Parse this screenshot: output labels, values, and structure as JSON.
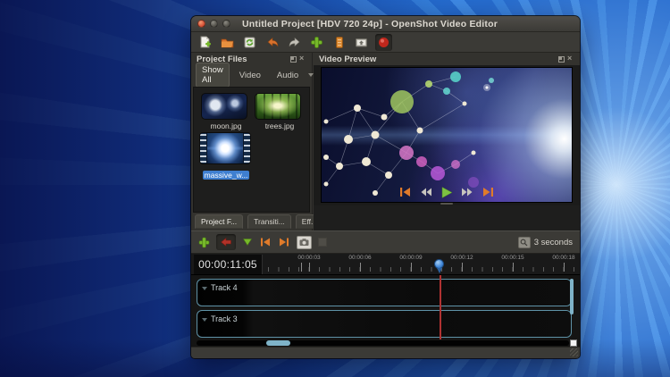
{
  "window": {
    "title": "Untitled Project [HDV 720 24p] - OpenShot Video Editor"
  },
  "toolbar": {
    "icons": [
      "new-project",
      "open-project",
      "save-project",
      "undo",
      "redo",
      "import-files",
      "choose-profile",
      "export-video",
      "record"
    ]
  },
  "project_files": {
    "title": "Project Files",
    "filter_tabs": [
      {
        "label": "Show All",
        "selected": true
      },
      {
        "label": "Video",
        "selected": false
      },
      {
        "label": "Audio",
        "selected": false
      }
    ],
    "files": [
      {
        "name": "moon.jpg",
        "type": "image",
        "selected": false
      },
      {
        "name": "trees.jpg",
        "type": "image",
        "selected": false
      },
      {
        "name": "massive_w...",
        "type": "video",
        "selected": true
      }
    ]
  },
  "video_preview": {
    "title": "Video Preview",
    "controls": [
      "jump-to-start",
      "rewind",
      "play",
      "fast-forward",
      "jump-to-end"
    ]
  },
  "panel_tabs": [
    {
      "label": "Project F...",
      "selected": true
    },
    {
      "label": "Transiti...",
      "selected": false
    },
    {
      "label": "Eff...",
      "selected": false
    }
  ],
  "timeline": {
    "toolbar_icons": [
      "add-track",
      "snapping",
      "add-marker",
      "previous-marker",
      "next-marker",
      "razor",
      "disabled-tool"
    ],
    "zoom_label": "3 seconds",
    "current_time": "00:00:11:05",
    "ruler_labels": [
      "00:00:03",
      "00:00:06",
      "00:00:09",
      "00:00:12",
      "00:00:15",
      "00:00:18"
    ],
    "tracks": [
      {
        "name": "Track 4"
      },
      {
        "name": "Track 3"
      }
    ]
  },
  "colors": {
    "accent_blue": "#3f86d8",
    "playhead_red": "#b03232",
    "track_border": "#5f93a8",
    "selection_blue": "#3f7fd0",
    "wallpaper_base": "#1a57c4",
    "wallpaper_ray": "#3a87e2"
  }
}
